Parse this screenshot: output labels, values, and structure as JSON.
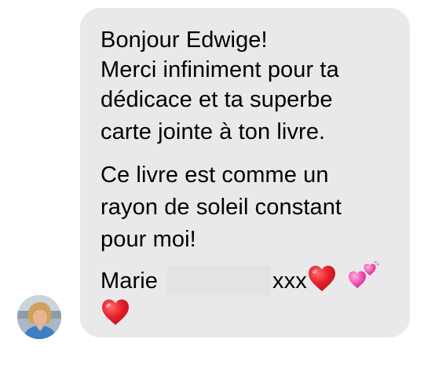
{
  "conversation": {
    "message": {
      "lines": [
        "Bonjour Edwige!",
        "Merci infiniment pour ta",
        "dédicace et ta superbe",
        "carte jointe à ton livre.",
        "Ce livre est comme un",
        "rayon de soleil constant",
        "pour moi!"
      ],
      "signature_name": "Marie",
      "signature_suffix": "xxx"
    },
    "sender": {
      "avatar_icon": "person-photo-avatar"
    }
  },
  "colors": {
    "bubble_bg": "#e9e9eb",
    "text": "#000000",
    "heart": "#e6212b",
    "sparkling_hearts": "#f24fae"
  },
  "icons": {
    "heart": "red-heart-icon",
    "two_hearts": "two-hearts-icon"
  }
}
